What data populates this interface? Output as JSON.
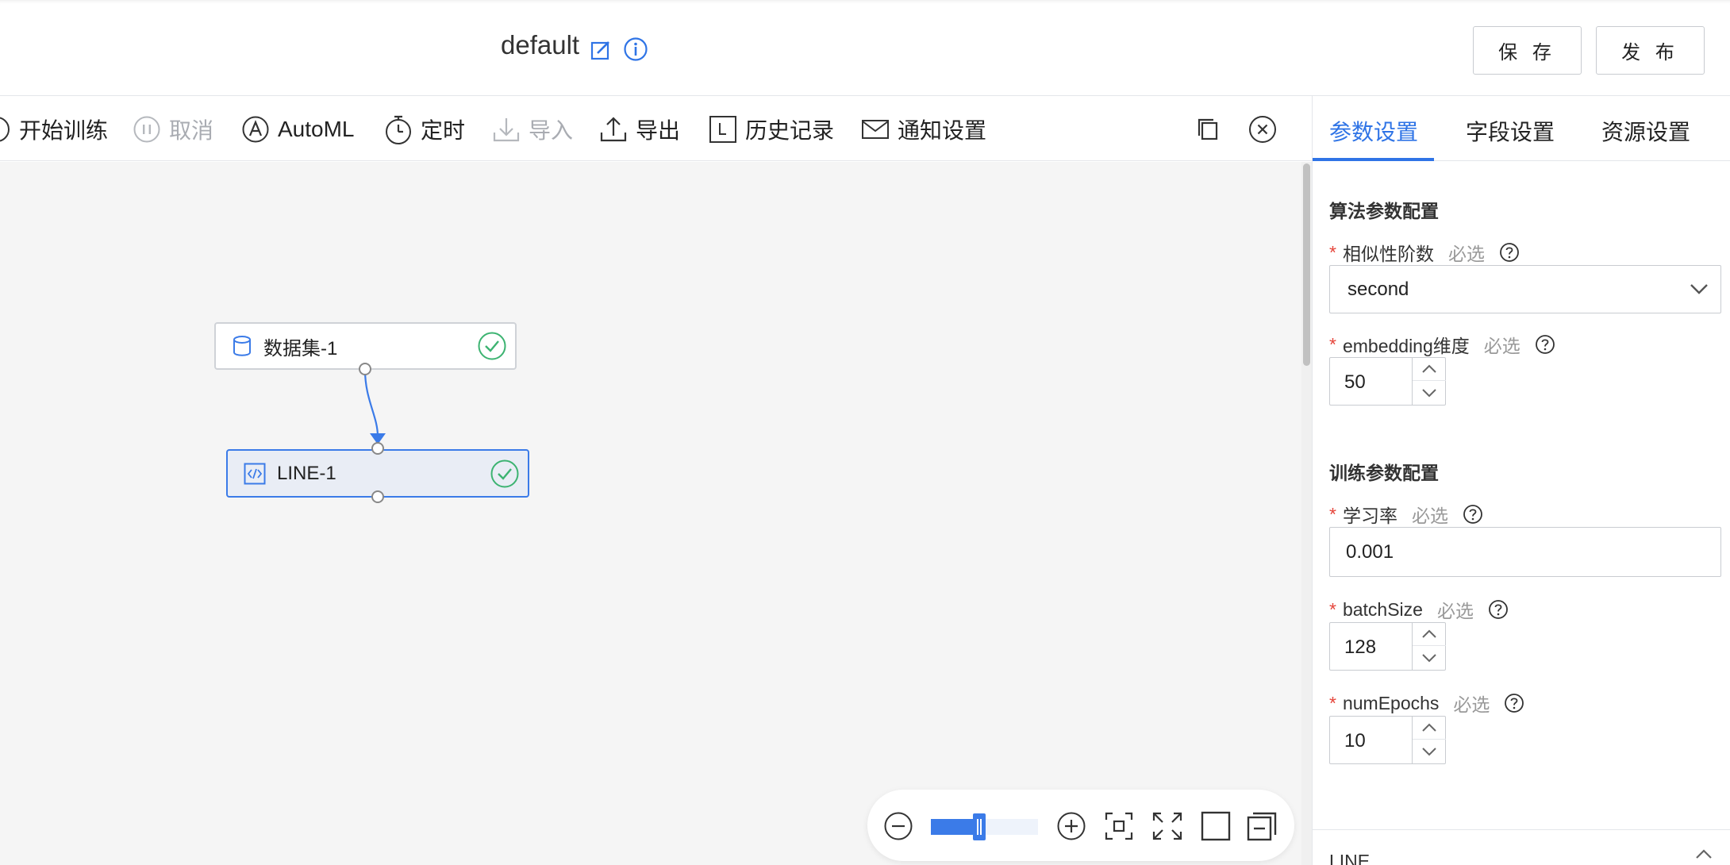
{
  "header": {
    "title": "default",
    "save_label": "保 存",
    "publish_label": "发 布"
  },
  "toolbar": {
    "items": [
      {
        "label": "开始训练",
        "icon": "play-circle-icon",
        "disabled": false
      },
      {
        "label": "取消",
        "icon": "pause-circle-icon",
        "disabled": true
      },
      {
        "label": "AutoML",
        "icon": "automl-icon",
        "disabled": false
      },
      {
        "label": "定时",
        "icon": "timer-icon",
        "disabled": false
      },
      {
        "label": "导入",
        "icon": "import-icon",
        "disabled": true
      },
      {
        "label": "导出",
        "icon": "export-icon",
        "disabled": false
      },
      {
        "label": "历史记录",
        "icon": "history-icon",
        "disabled": false
      },
      {
        "label": "通知设置",
        "icon": "mail-icon",
        "disabled": false
      }
    ]
  },
  "canvas": {
    "nodes": [
      {
        "label": "数据集-1",
        "icon": "database-icon",
        "status": "success"
      },
      {
        "label": "LINE-1",
        "icon": "code-icon",
        "status": "success",
        "selected": true
      }
    ],
    "zoom_level": 0.45
  },
  "panel": {
    "tabs": [
      {
        "label": "参数设置",
        "active": true
      },
      {
        "label": "字段设置",
        "active": false
      },
      {
        "label": "资源设置",
        "active": false
      }
    ],
    "algo_section_title": "算法参数配置",
    "train_section_title": "训练参数配置",
    "required_mark": "*",
    "optional_text": "必选",
    "fields": {
      "similarity_order": {
        "label": "相似性阶数",
        "value": "second"
      },
      "embedding_dim": {
        "label": "embedding维度",
        "value": "50"
      },
      "learning_rate": {
        "label": "学习率",
        "value": "0.001"
      },
      "batch_size": {
        "label": "batchSize",
        "value": "128"
      },
      "num_epochs": {
        "label": "numEpochs",
        "value": "10"
      }
    },
    "bottom_section_title": "LINE"
  },
  "colors": {
    "accent": "#2f74e6",
    "success": "#3cb371",
    "required": "#e5453b",
    "canvas_bg": "#f5f5f5"
  }
}
